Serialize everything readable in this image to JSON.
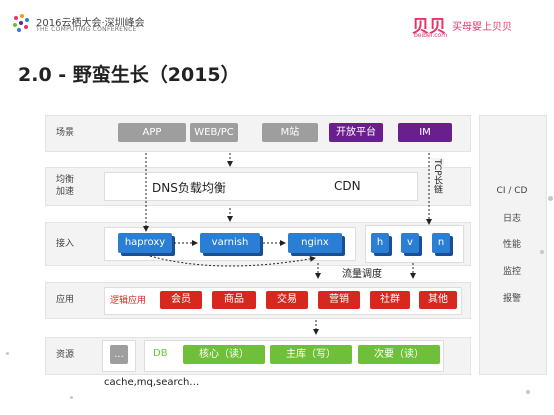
{
  "header": {
    "event_title": "2016云栖大会·深圳峰会",
    "event_subtitle": "THE COMPUTING CONFERENCE",
    "brand_name": "贝贝",
    "brand_url": "beibei.com",
    "brand_slogan": "买母婴上贝贝"
  },
  "slide_title": "2.0 - 野蛮生长（2015）",
  "rows": {
    "scene": {
      "label": "场景",
      "items": [
        "APP",
        "WEB/PC",
        "M站",
        "开放平台",
        "IM"
      ]
    },
    "lb": {
      "label_line1": "均衡",
      "label_line2": "加速",
      "dns_text": "DNS负载均衡",
      "cdn_text": "CDN",
      "tcp_text": "TCP长链"
    },
    "access": {
      "label": "接入",
      "items": [
        "haproxy",
        "varnish",
        "nginx"
      ],
      "servers": [
        "h",
        "v",
        "n"
      ],
      "routing_text": "流量调度"
    },
    "app": {
      "label": "应用",
      "logic_label": "逻辑应用",
      "items": [
        "会员",
        "商品",
        "交易",
        "营销",
        "社群",
        "其他"
      ]
    },
    "resource": {
      "label": "资源",
      "ellipsis": "...",
      "db_label": "DB",
      "items": [
        "核心（读）",
        "主库（写）",
        "次要（读）"
      ],
      "footnote": "cache,mq,search…"
    }
  },
  "side_panel": [
    "CI / CD",
    "日志",
    "性能",
    "监控",
    "报警"
  ],
  "colors": {
    "gray": "#9e9e9e",
    "purple": "#6b1f8e",
    "blue": "#2a7fd4",
    "red": "#d7281f",
    "green": "#6fbf3b",
    "brand_pink": "#e8336b"
  }
}
